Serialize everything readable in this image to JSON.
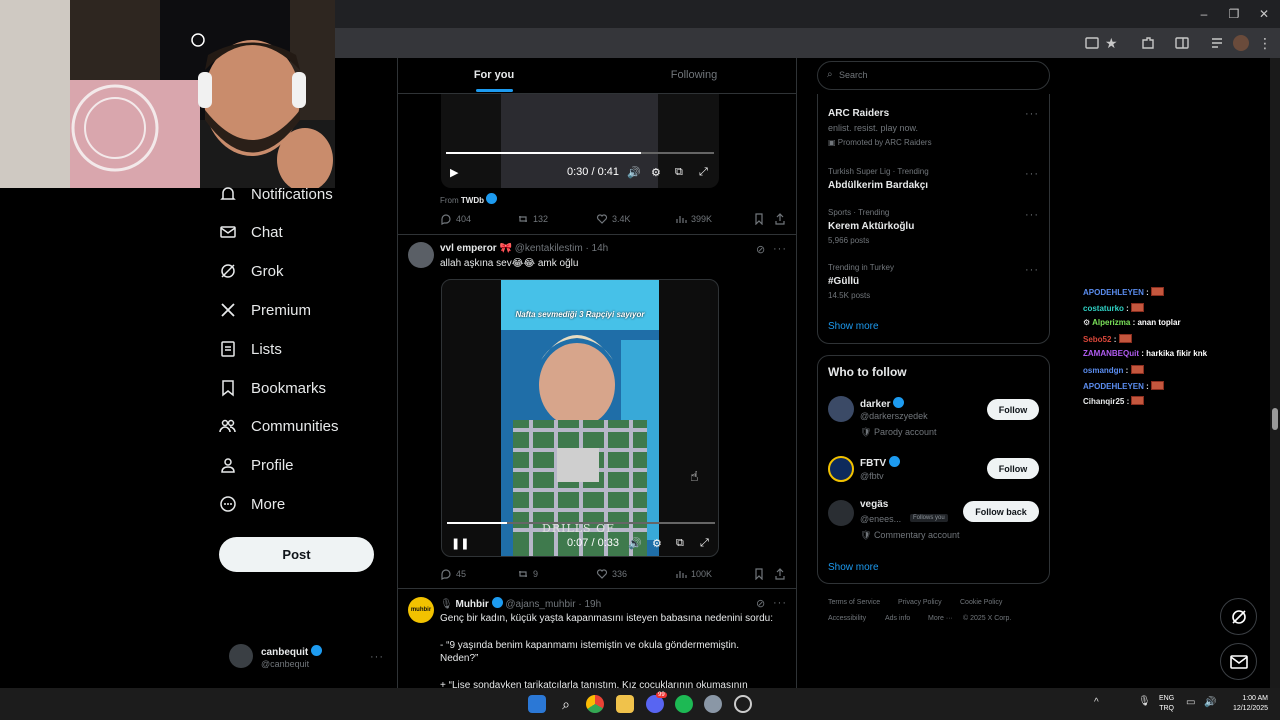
{
  "main": {
    "tabs": [
      {
        "label": "For you"
      },
      {
        "label": "Following"
      }
    ],
    "video1": {
      "time": "0:30 / 0:41",
      "from_label": "From",
      "from_name": "TWDb"
    },
    "tweet1_stats": {
      "replies": "404",
      "retweets": "132",
      "likes": "3.4K",
      "views": "399K"
    },
    "tweet2": {
      "name": "vvl emperor",
      "handle": "@kentakilestim",
      "time": "· 14h",
      "text": "allah aşkına sev😂😂 amk oğlu",
      "video_caption": "Nafta sevmediği 3 Rapçiyi sayıyor",
      "video_overlay": "DRILLS OF",
      "video_time": "0:07 / 0:33",
      "stats": {
        "replies": "45",
        "retweets": "9",
        "likes": "336",
        "views": "100K"
      }
    },
    "tweet3": {
      "name": "Muhbir",
      "handle": "@ajans_muhbir",
      "time": "· 19h",
      "avatar_text": "muhbir",
      "line1": "Genç bir kadın, küçük yaşta kapanmasını isteyen babasına nedenini sordu:",
      "line2": "- “9 yaşında benim kapanmamı istemiştin ve okula göndermemiştin. Neden?”",
      "line3": "+ “Lise sondayken tarikatçılarla tanıştım. Kız çocuklarının okumasının"
    }
  },
  "nav": {
    "items": [
      {
        "label": "Notifications"
      },
      {
        "label": "Chat"
      },
      {
        "label": "Grok"
      },
      {
        "label": "Premium"
      },
      {
        "label": "Lists"
      },
      {
        "label": "Bookmarks"
      },
      {
        "label": "Communities"
      },
      {
        "label": "Profile"
      },
      {
        "label": "More"
      }
    ],
    "post_label": "Post",
    "account": {
      "name": "canbequit",
      "handle": "@canbequit"
    }
  },
  "sidebar": {
    "search_placeholder": "Search",
    "promo": {
      "title": "ARC Raiders",
      "tagline": "enlist. resist. play now.",
      "promoted": "Promoted by ARC Raiders"
    },
    "trends": [
      {
        "context": "Turkish Super Lig · Trending",
        "name": "Abdülkerim Bardakçı",
        "count": ""
      },
      {
        "context": "Sports · Trending",
        "name": "Kerem Aktürkoğlu",
        "count": "5,966 posts"
      },
      {
        "context": "Trending in Turkey",
        "name": "#Güllü",
        "count": "14.5K posts"
      }
    ],
    "show_more": "Show more",
    "who_to_follow": {
      "title": "Who to follow",
      "accounts": [
        {
          "name": "darker",
          "handle": "@darkerszyedek",
          "label": "Parody account",
          "button": "Follow"
        },
        {
          "name": "FBTV",
          "handle": "@fbtv",
          "label": "",
          "button": "Follow"
        },
        {
          "name": "vegäs",
          "handle": "@enees...",
          "follows_you": "Follows you",
          "label": "Commentary account",
          "button": "Follow back"
        }
      ],
      "show_more": "Show more"
    },
    "footer": {
      "links": [
        "Terms of Service",
        "Privacy Policy",
        "Cookie Policy",
        "Accessibility",
        "Ads info",
        "More ···"
      ],
      "copyright": "© 2025 X Corp."
    }
  },
  "chat": [
    {
      "user": "APODEHLEYEN",
      "color": "#5b8def",
      "msg": ""
    },
    {
      "user": "costaturko",
      "color": "#2fd1c4",
      "msg": ""
    },
    {
      "user": "Alperizma",
      "color": "#7be35a",
      "msg": "anan toplar"
    },
    {
      "user": "Sebo52",
      "color": "#d9473a",
      "msg": ""
    },
    {
      "user": "ZAMANBEQuit",
      "color": "#b05cf0",
      "msg": "harkika fikir knk"
    },
    {
      "user": "osmandgn",
      "color": "#5b8def",
      "msg": ""
    },
    {
      "user": "APODEHLEYEN",
      "color": "#5b8def",
      "msg": ""
    },
    {
      "user": "Cihanqir25",
      "color": "#e7e9ea",
      "msg": ""
    }
  ],
  "taskbar": {
    "lang": "ENG",
    "layout": "TRQ",
    "time": "1:00 AM",
    "date": "12/12/2025",
    "discord_badge": "99"
  },
  "colors": {
    "accent": "#1d9bf0",
    "border": "#2f3336",
    "muted": "#71767b"
  }
}
